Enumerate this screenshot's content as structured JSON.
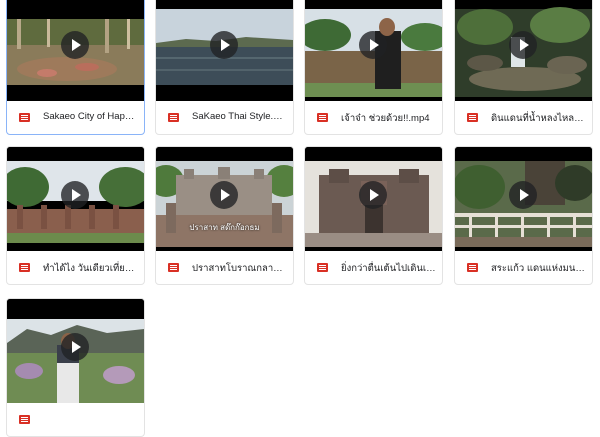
{
  "files": [
    {
      "name": "Sakaeo City of Happi...",
      "icon": "video-file-icon",
      "selected": true
    },
    {
      "name": "SaKaeo Thai Style.mov",
      "icon": "video-file-icon"
    },
    {
      "name": "เจ้าจ๋า ช่วยด้วย!!.mp4",
      "icon": "video-file-icon"
    },
    {
      "name": "ดินแดนที่น้ำหลงไหล.mp4",
      "icon": "video-file-icon"
    },
    {
      "name": "ทำได้ไง วันเดียวเที่ยวสระ...",
      "icon": "video-file-icon"
    },
    {
      "name": "ปราสาทโบราณกลางป่า...",
      "icon": "video-file-icon",
      "caption": "ปราสาท สด๊กก๊อกธม"
    },
    {
      "name": "ยิ่งกว่าตื่นเต้นไปเดินเล่น...",
      "icon": "video-file-icon"
    },
    {
      "name": "สระแก้ว แดนแห่งมนต์ข...",
      "icon": "video-file-icon"
    },
    {
      "name": "",
      "icon": "video-file-icon"
    }
  ],
  "colors": {
    "video_icon": "#d93025",
    "selected_border": "#8ab4f8"
  }
}
